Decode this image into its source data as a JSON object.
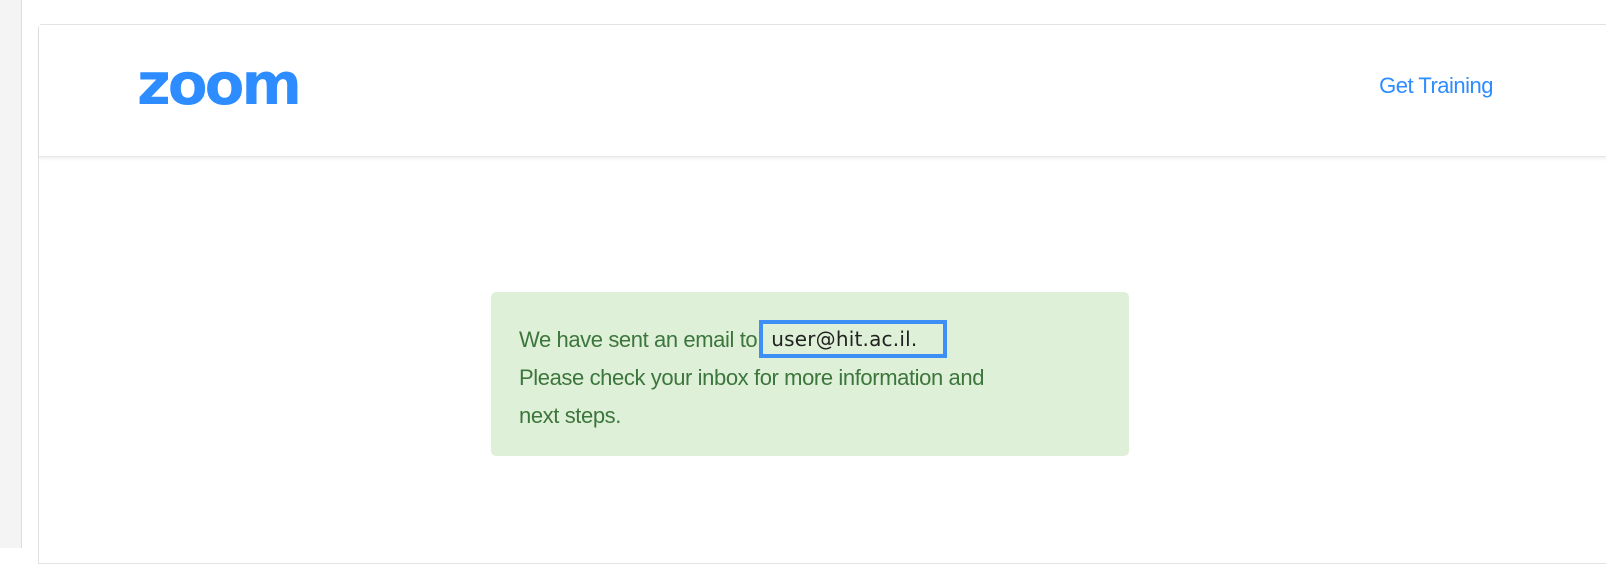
{
  "header": {
    "logo_text": "zoom",
    "get_training_label": "Get Training"
  },
  "notice": {
    "line1_prefix": "We have sent an email to",
    "email": "user@hit.ac.il.",
    "line2": "Please check your inbox for more information and",
    "line3": "next steps."
  },
  "colors": {
    "brand_blue": "#2d8cff",
    "notice_bg": "#dff0d8",
    "notice_text": "#3c763d",
    "highlight_border": "#3d8ef5"
  }
}
